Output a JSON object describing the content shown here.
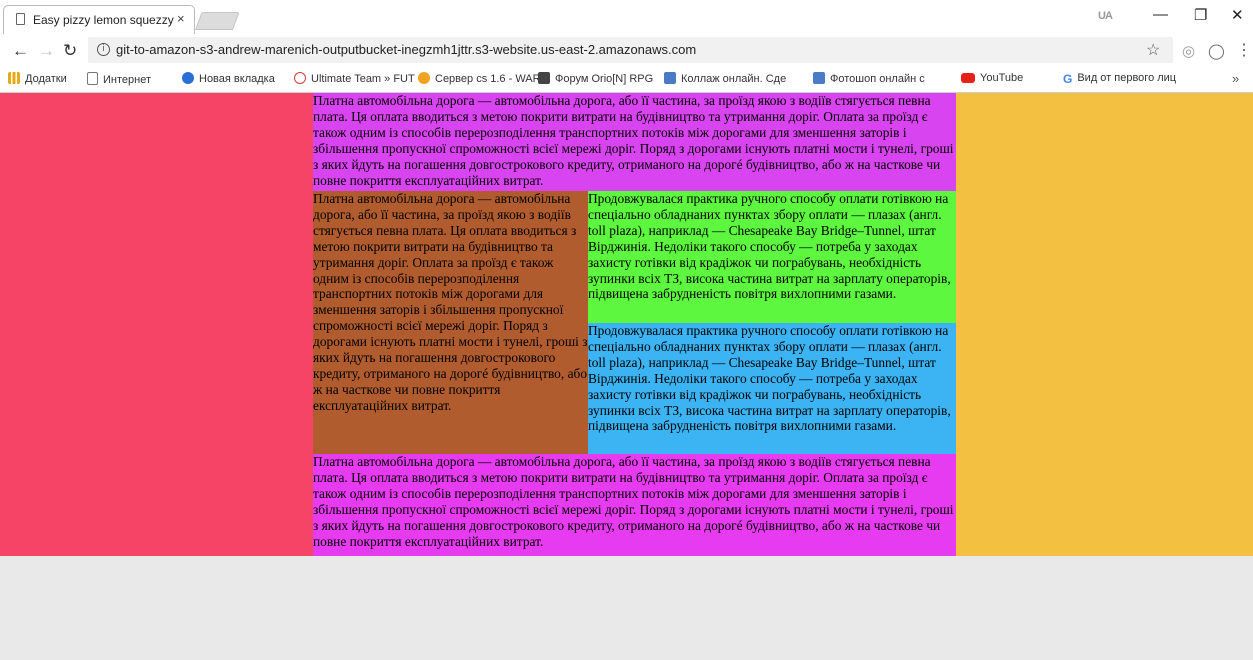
{
  "browser": {
    "tab_title": "Easy pizzy lemon squezzy",
    "tab_close": "×",
    "lang_badge": "UA",
    "url": "git-to-amazon-s3-andrew-marenich-outputbucket-inegzmh1jttr.s3-website.us-east-2.amazonaws.com",
    "bookmarks": [
      {
        "label": "Додатки",
        "color": "#e8a917"
      },
      {
        "label": "Интернет",
        "color": "#ffffff"
      },
      {
        "label": "Новая вкладка",
        "color": "#2a6fd6"
      },
      {
        "label": "Ultimate Team » FUT",
        "color": "#d33c3c"
      },
      {
        "label": "Сервер cs 1.6 - WAR",
        "color": "#f0a11f"
      },
      {
        "label": "Форум Orio[N] RPG",
        "color": "#444444"
      },
      {
        "label": "Коллаж онлайн. Сде",
        "color": "#4a7bc4"
      },
      {
        "label": "Фотошоп онлайн с",
        "color": "#4a7bc4"
      },
      {
        "label": "YouTube",
        "color": "#e62117"
      },
      {
        "label": "Вид от первого лиц",
        "color": "#4285f4"
      }
    ],
    "more": "»"
  },
  "content": {
    "top_text": "Платна автомобільна дорога — автомобільна дорога, або її частина, за проїзд якою з водіїв стягується певна плата. Ця оплата вводиться з метою покрити витрати на будівництво та утримання доріг. Оплата за проїзд є також одним із способів перерозподілення транспортних потоків між дорогами для зменшення заторів і збільшення пропускної спроможності всієї мережі доріг. Поряд з дорогами існують платні мости і тунелі, гроші з яких йдуть на погашення довгострокового кредиту, отриманого на дорогé будівництво, або ж на часткове чи повне покриття експлуатаційних витрат.",
    "left_text": "Платна автомобільна дорога — автомобільна дорога, або її частина, за проїзд якою з водіїв стягується певна плата. Ця оплата вводиться з метою покрити витрати на будівництво та утримання доріг. Оплата за проїзд є також одним із способів перерозподілення транспортних потоків між дорогами для зменшення заторів і збільшення пропускної спроможності всієї мережі доріг. Поряд з дорогами існують платні мости і тунелі, гроші з яких йдуть на погашення довгострокового кредиту, отриманого на дорогé будівництво, або ж на часткове чи повне покриття експлуатаційних витрат.",
    "green_text": "Продовжувалася практика ручного способу оплати готівкою на спеціально обладнаних пунктах збору оплати — плазах (англ. toll plaza), наприклад — Chesapeake Bay Bridge–Tunnel, штат Вірджинія. Недоліки такого способу — потреба у заходах захисту готівки від крадіжок чи пограбувань, необхідність зупинки всіх ТЗ, висока частина витрат на зарплату операторів, підвищена забрудненість повітря вихлопними газами.",
    "blue_text": "Продовжувалася практика ручного способу оплати готівкою на спеціально обладнаних пунктах збору оплати — плазах (англ. toll plaza), наприклад — Chesapeake Bay Bridge–Tunnel, штат Вірджинія. Недоліки такого способу — потреба у заходах захисту готівки від крадіжок чи пограбувань, необхідність зупинки всіх ТЗ, висока частина витрат на зарплату операторів, підвищена забрудненість повітря вихлопними газами.",
    "bottom_text": "Платна автомобільна дорога — автомобільна дорога, або її частина, за проїзд якою з водіїв стягується певна плата. Ця оплата вводиться з метою покрити витрати на будівництво та утримання доріг. Оплата за проїзд є також одним із способів перерозподілення транспортних потоків між дорогами для зменшення заторів і збільшення пропускної спроможності всієї мережі доріг. Поряд з дорогами існують платні мости і тунелі, гроші з яких йдуть на погашення довгострокового кредиту, отриманого на дорогé будівництво, або ж на часткове чи повне покриття експлуатаційних витрат."
  },
  "colors": {
    "left_side": "#f54466",
    "right_side": "#f3c042",
    "top_block": "#d844ef",
    "left_block": "#b15c2e",
    "green_block": "#5ef740",
    "blue_block": "#3cb3f3",
    "bottom_block": "#e73bf1"
  }
}
